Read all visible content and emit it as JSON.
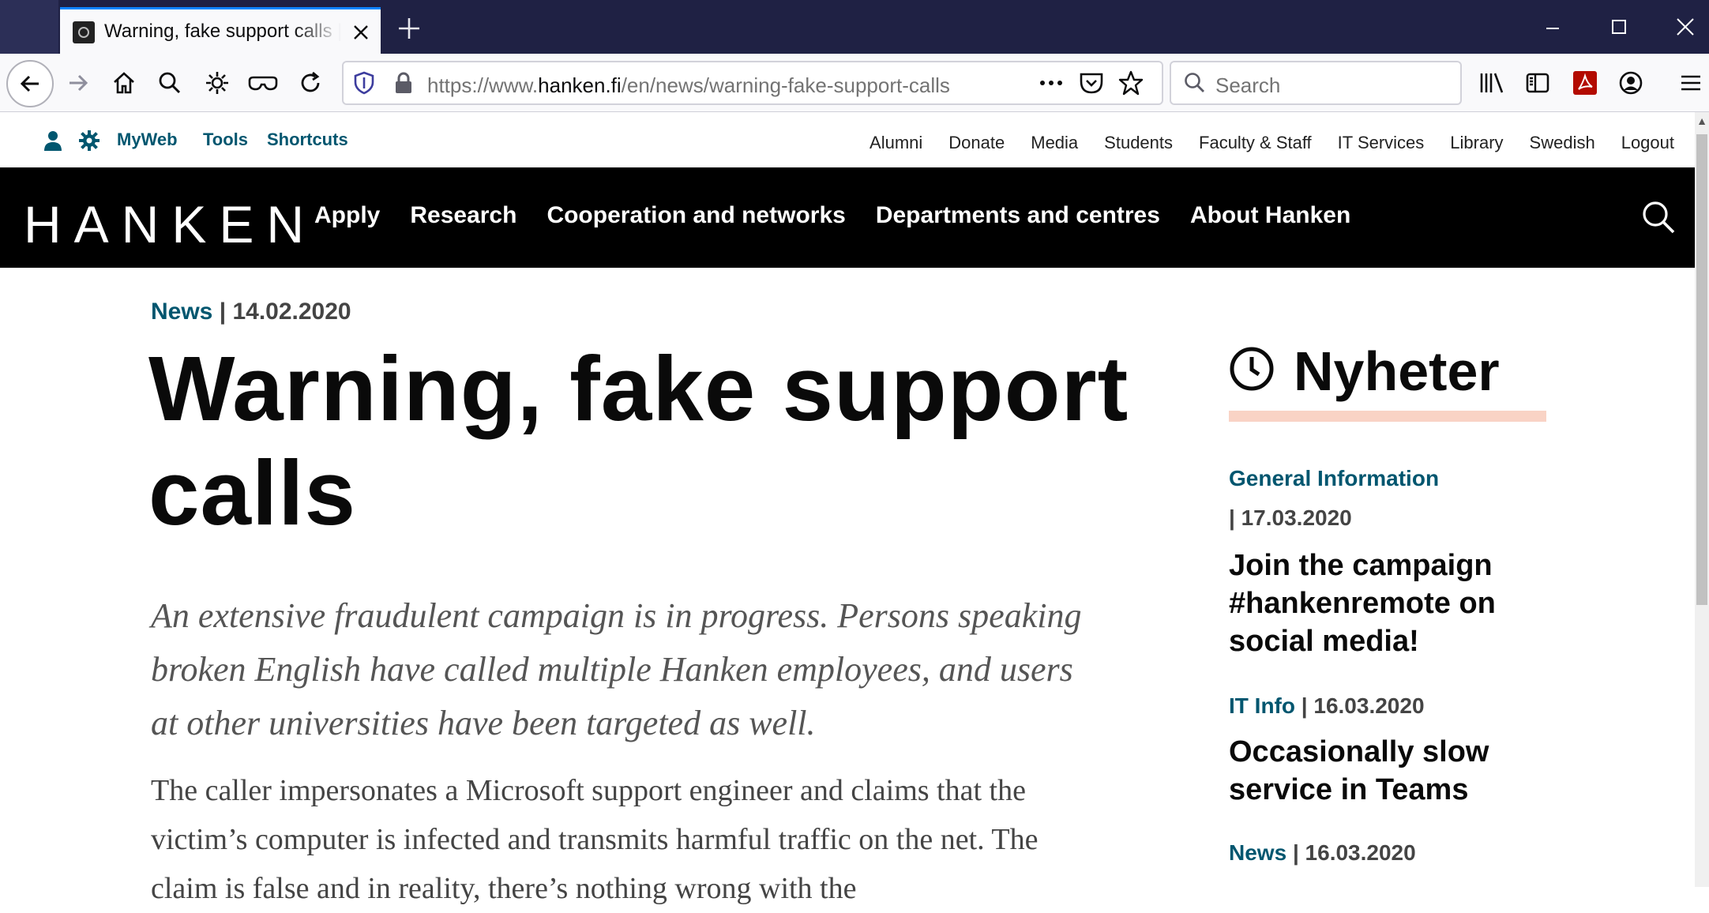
{
  "browser": {
    "tab": {
      "title": "Warning, fake support calls | hanken.fi"
    },
    "url": {
      "prefix": "https://www.",
      "domain": "hanken.fi",
      "path": "/en/news/warning-fake-support-calls"
    },
    "search_placeholder": "Search",
    "icons": [
      "back-icon",
      "forward-icon",
      "home-icon",
      "search-icon",
      "gear-icon",
      "mask-icon",
      "reload-icon",
      "shield-icon",
      "lock-icon",
      "more-icon",
      "pocket-icon",
      "bookmark-star-icon",
      "library-icon",
      "sidebar-icon",
      "pdf-icon",
      "account-icon",
      "menu-icon"
    ]
  },
  "utility": {
    "left": [
      "MyWeb",
      "Tools",
      "Shortcuts"
    ],
    "links": [
      "Alumni",
      "Donate",
      "Media",
      "Students",
      "Faculty & Staff",
      "IT Services",
      "Library",
      "Swedish",
      "Logout"
    ]
  },
  "site": {
    "logo": "HANKEN",
    "menu": [
      "Apply",
      "Research",
      "Cooperation and networks",
      "Departments and centres",
      "About Hanken"
    ]
  },
  "article": {
    "category": "News",
    "separator": "|",
    "date": "14.02.2020",
    "title": "Warning, fake support calls",
    "lead": "An extensive fraudulent campaign is in progress. Persons speaking broken English have called multiple Hanken employees, and users at other universities have been targeted as well.",
    "body": "The caller impersonates a Microsoft support engineer and claims that the victim’s computer is infected and transmits harmful traffic on the net. The claim is false and in reality, there’s nothing wrong with the"
  },
  "sidebar": {
    "title": "Nyheter",
    "items": [
      {
        "category": "General Information",
        "date": "| 17.03.2020",
        "title": "Join the campaign #hankenremote on social media!"
      },
      {
        "category": "IT Info",
        "date": "| 16.03.2020",
        "title": "Occasionally slow service in Teams"
      },
      {
        "category": "News",
        "date": "| 16.03.2020",
        "title": ""
      }
    ]
  },
  "colors": {
    "accent": "#00566f",
    "nav_bg": "#000000",
    "underline": "#f9d3c5",
    "titlebar": "#1f2144"
  }
}
